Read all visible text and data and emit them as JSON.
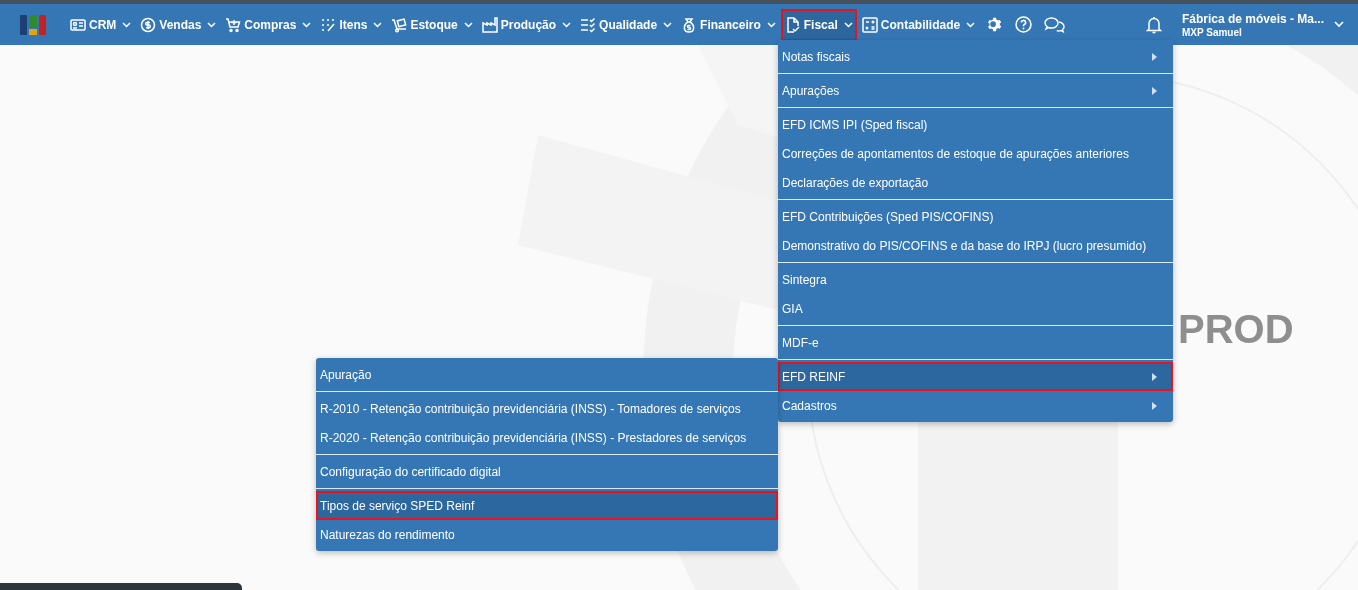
{
  "navbar": {
    "items": [
      {
        "label": "CRM",
        "kind": "crm",
        "selected": false
      },
      {
        "label": "Vendas",
        "kind": "dollar",
        "selected": false
      },
      {
        "label": "Compras",
        "kind": "cart",
        "selected": false
      },
      {
        "label": "Itens",
        "kind": "grid",
        "selected": false
      },
      {
        "label": "Estoque",
        "kind": "dolly",
        "selected": false
      },
      {
        "label": "Produção",
        "kind": "factory",
        "selected": false
      },
      {
        "label": "Qualidade",
        "kind": "checklist",
        "selected": false
      },
      {
        "label": "Financeiro",
        "kind": "moneybag",
        "selected": false
      },
      {
        "label": "Fiscal",
        "kind": "document",
        "selected": true
      },
      {
        "label": "Contabilidade",
        "kind": "calculator",
        "selected": false
      }
    ],
    "company": "Fábrica de móveis - Ma...",
    "user": "MXP Samuel"
  },
  "background": {
    "watermark": "PROD"
  },
  "fiscal_menu": {
    "groups": [
      [
        {
          "label": "Notas fiscais",
          "has_submenu": true,
          "selected": false
        }
      ],
      [
        {
          "label": "Apurações",
          "has_submenu": true,
          "selected": false
        }
      ],
      [
        {
          "label": "EFD ICMS IPI (Sped fiscal)",
          "has_submenu": false,
          "selected": false
        },
        {
          "label": "Correções de apontamentos de estoque de apurações anteriores",
          "has_submenu": false,
          "selected": false
        },
        {
          "label": "Declarações de exportação",
          "has_submenu": false,
          "selected": false
        }
      ],
      [
        {
          "label": "EFD Contribuições (Sped PIS/COFINS)",
          "has_submenu": false,
          "selected": false
        },
        {
          "label": "Demonstrativo do PIS/COFINS e da base do IRPJ (lucro presumido)",
          "has_submenu": false,
          "selected": false
        }
      ],
      [
        {
          "label": "Sintegra",
          "has_submenu": false,
          "selected": false
        },
        {
          "label": "GIA",
          "has_submenu": false,
          "selected": false
        }
      ],
      [
        {
          "label": "MDF-e",
          "has_submenu": false,
          "selected": false
        }
      ],
      [
        {
          "label": "EFD REINF",
          "has_submenu": true,
          "selected": true
        },
        {
          "label": "Cadastros",
          "has_submenu": true,
          "selected": false
        }
      ]
    ]
  },
  "reinf_submenu": {
    "groups": [
      [
        {
          "label": "Apuração",
          "has_submenu": false,
          "selected": false
        }
      ],
      [
        {
          "label": "R-2010 - Retenção contribuição previdenciária (INSS) - Tomadores de serviços",
          "has_submenu": false,
          "selected": false
        },
        {
          "label": "R-2020 - Retenção contribuição previdenciária (INSS) - Prestadores de serviços",
          "has_submenu": false,
          "selected": false
        }
      ],
      [
        {
          "label": "Configuração do certificado digital",
          "has_submenu": false,
          "selected": false
        }
      ],
      [
        {
          "label": "Tipos de serviço SPED Reinf",
          "has_submenu": false,
          "selected": true
        },
        {
          "label": "Naturezas do rendimento",
          "has_submenu": false,
          "selected": false
        }
      ]
    ]
  }
}
